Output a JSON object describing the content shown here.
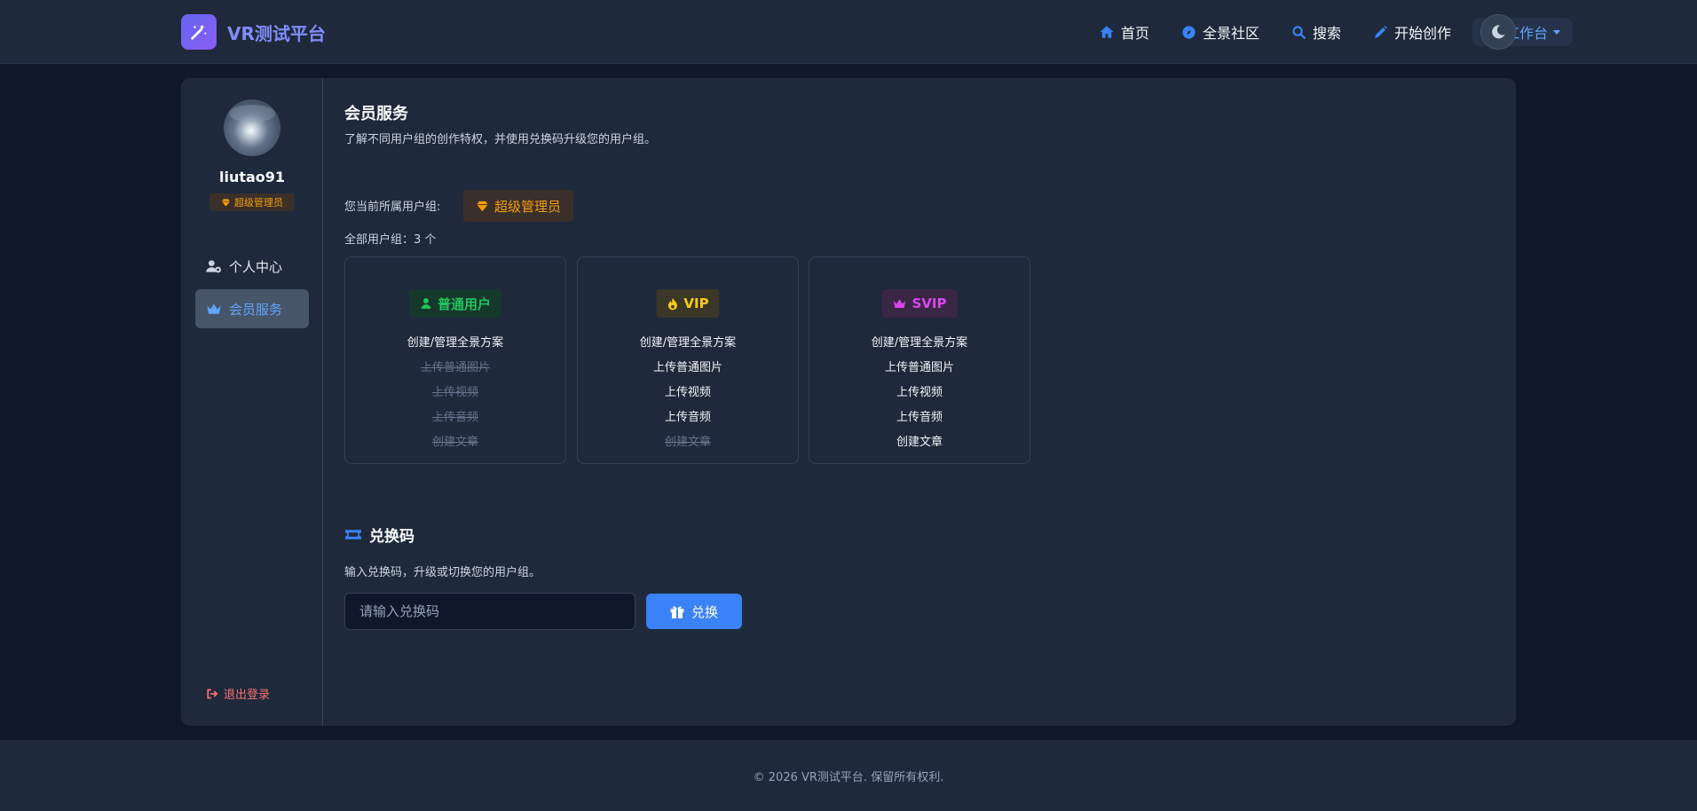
{
  "header": {
    "brand_title": "VR测试平台",
    "nav": [
      {
        "label": "首页",
        "icon": "home-icon"
      },
      {
        "label": "全景社区",
        "icon": "compass-icon"
      },
      {
        "label": "搜索",
        "icon": "search-icon"
      },
      {
        "label": "开始创作",
        "icon": "pencil-icon"
      }
    ],
    "workspace_label": "工作台",
    "theme_icon": "moon-icon"
  },
  "sidebar": {
    "username": "liutao91",
    "role": "超级管理员",
    "menu": [
      {
        "label": "个人中心",
        "icon": "user-cog-icon",
        "active": false
      },
      {
        "label": "会员服务",
        "icon": "crown-icon",
        "active": true
      }
    ],
    "logout_label": "退出登录"
  },
  "membership": {
    "title": "会员服务",
    "description": "了解不同用户组的创作特权，并使用兑换码升级您的用户组。",
    "current_label": "您当前所属用户组:",
    "current_group": "超级管理员",
    "all_groups_label": "全部用户组：3 个",
    "groups": [
      {
        "name": "普通用户",
        "icon": "user-icon",
        "color": "#22c55e",
        "permissions": [
          {
            "label": "创建/管理全景方案",
            "enabled": true
          },
          {
            "label": "上传普通图片",
            "enabled": false
          },
          {
            "label": "上传视频",
            "enabled": false
          },
          {
            "label": "上传音频",
            "enabled": false
          },
          {
            "label": "创建文章",
            "enabled": false
          }
        ]
      },
      {
        "name": "VIP",
        "icon": "flame-icon",
        "color": "#facc15",
        "permissions": [
          {
            "label": "创建/管理全景方案",
            "enabled": true
          },
          {
            "label": "上传普通图片",
            "enabled": true
          },
          {
            "label": "上传视频",
            "enabled": true
          },
          {
            "label": "上传音频",
            "enabled": true
          },
          {
            "label": "创建文章",
            "enabled": false
          }
        ]
      },
      {
        "name": "SVIP",
        "icon": "crown-icon",
        "color": "#d946ef",
        "permissions": [
          {
            "label": "创建/管理全景方案",
            "enabled": true
          },
          {
            "label": "上传普通图片",
            "enabled": true
          },
          {
            "label": "上传视频",
            "enabled": true
          },
          {
            "label": "上传音频",
            "enabled": true
          },
          {
            "label": "创建文章",
            "enabled": true
          }
        ]
      }
    ]
  },
  "redeem": {
    "title": "兑换码",
    "description": "输入兑换码，升级或切换您的用户组。",
    "placeholder": "请输入兑换码",
    "button_label": "兑换"
  },
  "footer": {
    "text": "© 2026 VR测试平台. 保留所有权利."
  },
  "colors": {
    "accent": "#3b82f6",
    "brand": "#818cf8",
    "admin": "#f59e0b",
    "danger": "#f87171"
  }
}
